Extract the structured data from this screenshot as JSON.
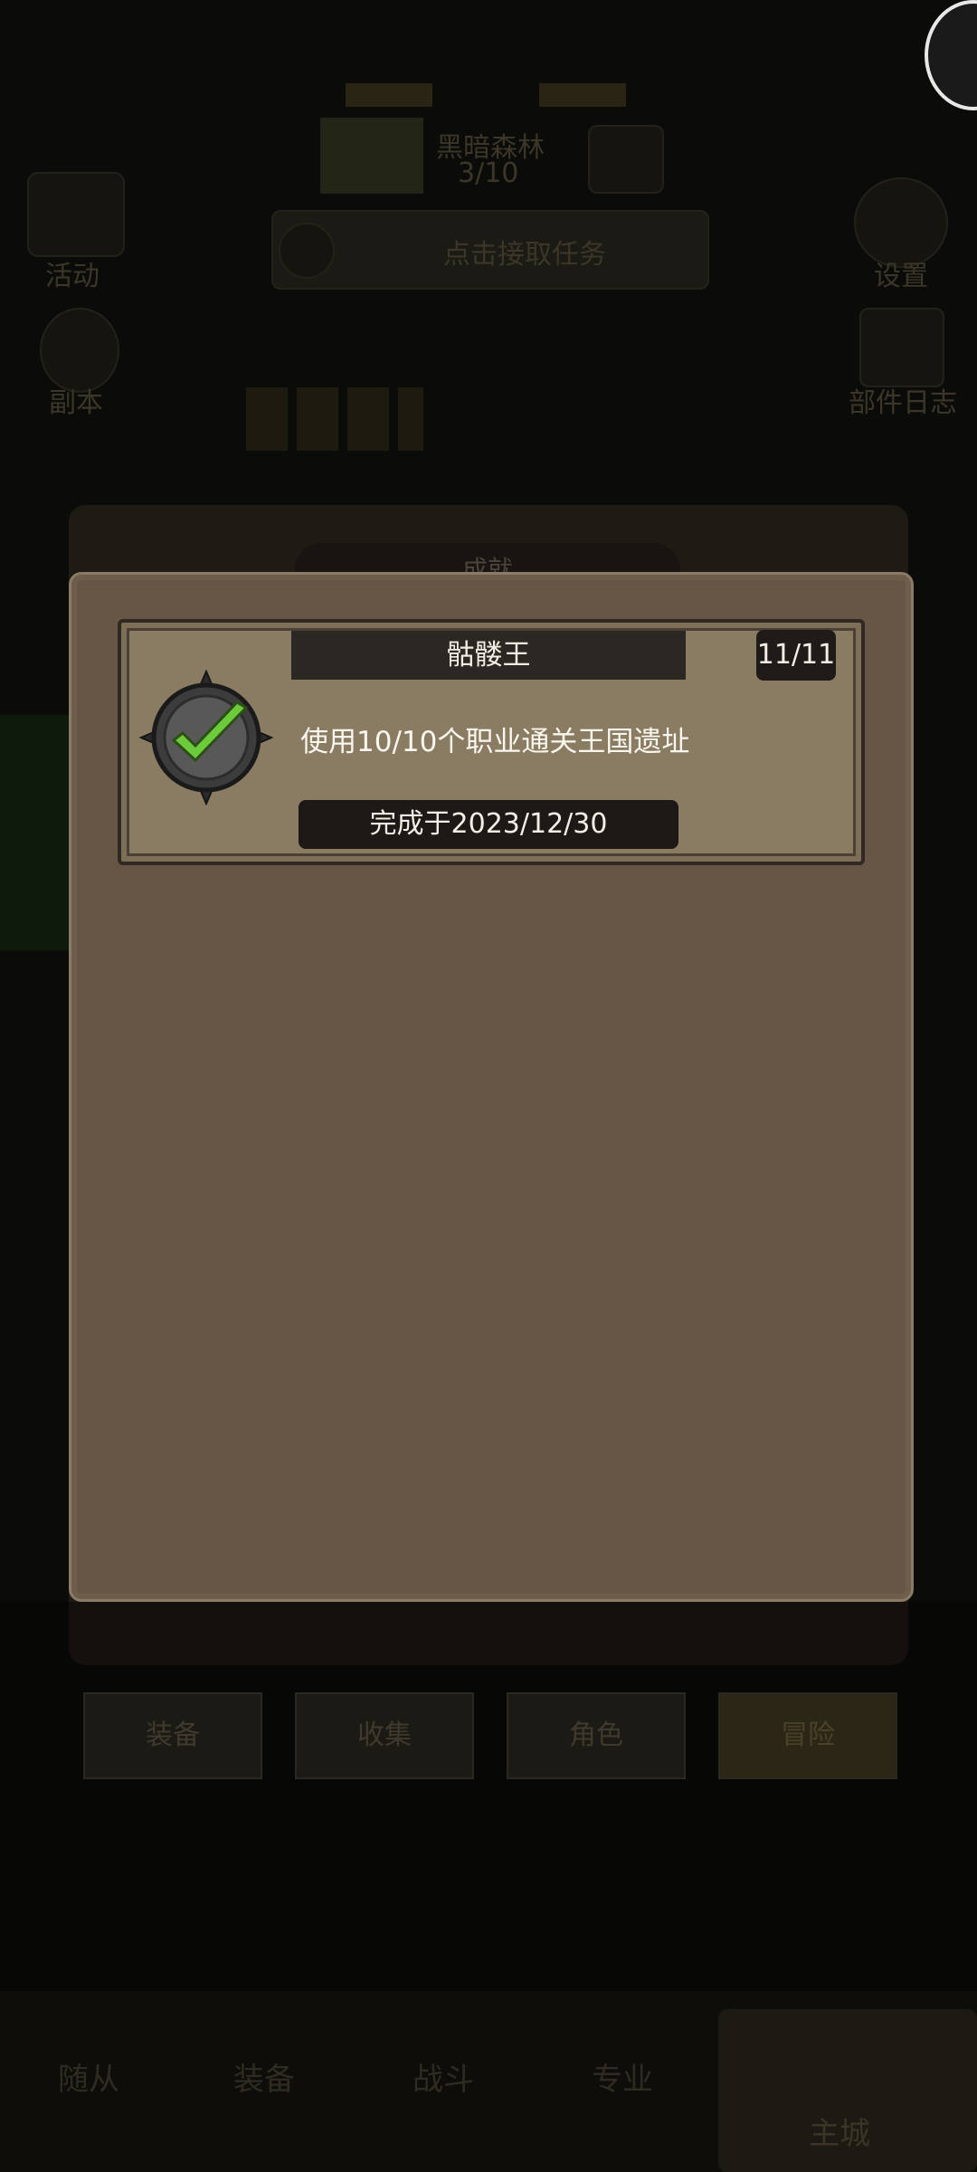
{
  "background": {
    "stage_name": "黑暗森林",
    "stage_progress": "3/10",
    "quest_prompt": "点击接取任务",
    "left_icons": [
      "活动",
      "副本"
    ],
    "right_icons": [
      "设置",
      "部件日志"
    ]
  },
  "modal": {
    "title": "成就",
    "achievement": {
      "name": "骷髅王",
      "count": "11/11",
      "description": "使用10/10个职业通关王国遗址",
      "completed": "完成于2023/12/30",
      "icon": "check-medal-icon"
    }
  },
  "tabs": [
    "装备",
    "收集",
    "角色",
    "冒险"
  ],
  "bottom_nav": {
    "items": [
      "随从",
      "装备",
      "战斗",
      "专业"
    ],
    "home": "主城"
  },
  "colors": {
    "panel": "#675645",
    "card": "#8a7b63",
    "check": "#6ccb3a"
  }
}
